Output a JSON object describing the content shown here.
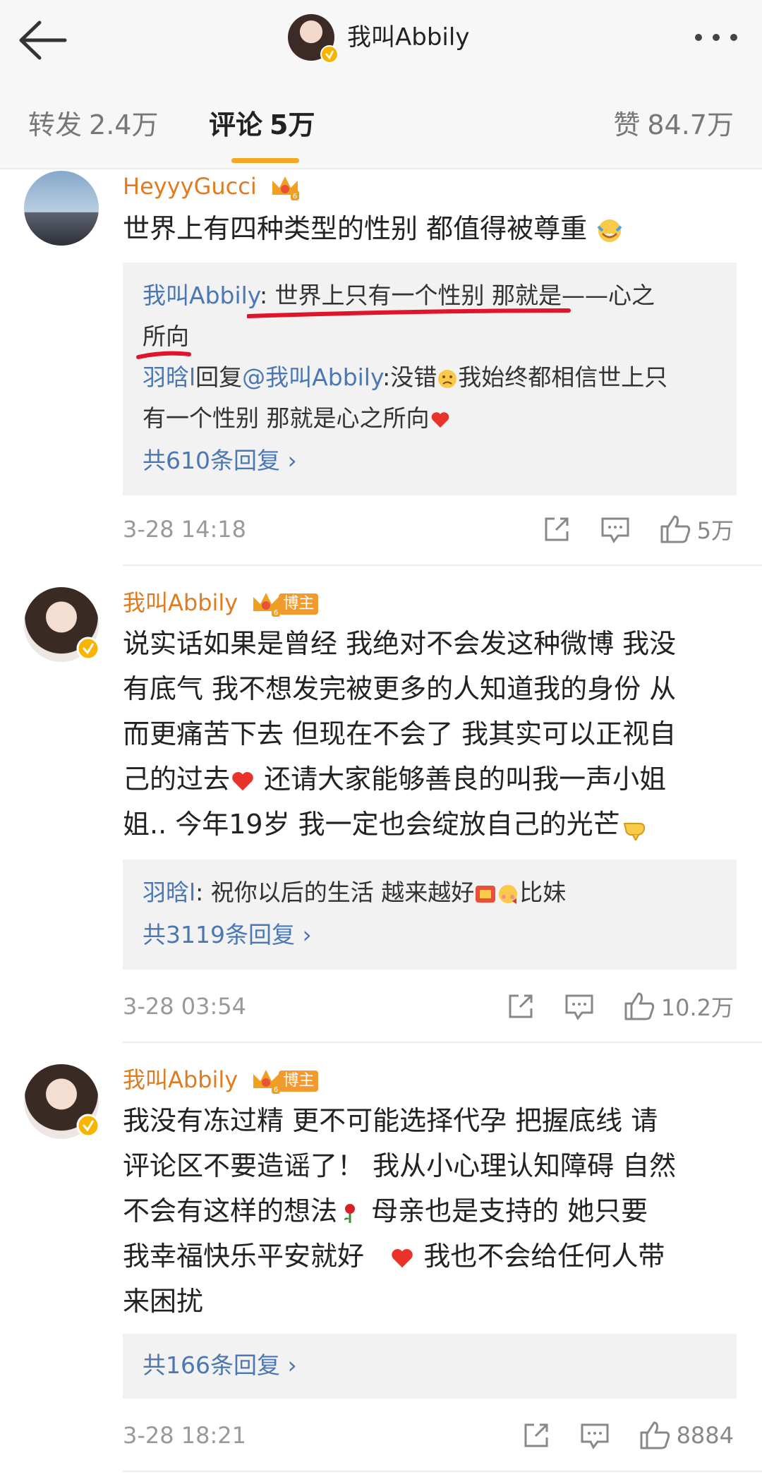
{
  "header": {
    "title": "我叫Abbily"
  },
  "tabs": {
    "repost_label": "转发",
    "repost_count": "2.4万",
    "comments_label": "评论",
    "comments_count": "5万",
    "likes_label": "赞",
    "likes_count": "84.7万"
  },
  "colors": {
    "accent": "#f5a623",
    "username": "#e07c1f",
    "link": "#4b78b3",
    "annotation_red": "#e0142b"
  },
  "comments": [
    {
      "username": "HeyyyGucci",
      "text": "世界上有四种类型的性别 都值得被尊重",
      "replies": [
        {
          "name": "我叫Abbily",
          "sep": ": ",
          "text_a": "世界上只有一个性别 那就是——心之",
          "text_b": "所向"
        },
        {
          "name": "羽晗l",
          "mid": "回复",
          "mention": "@我叫Abbily",
          "text_a": ":没错",
          "text_b": "我始终都相信世上只",
          "text_c": "有一个性别 那就是心之所向"
        }
      ],
      "more_replies": "共610条回复 ›",
      "time": "3-28 14:18",
      "like_count": "5万"
    },
    {
      "username": "我叫Abbily",
      "tag": "博主",
      "text_lines": [
        "说实话如果是曾经 我绝对不会发这种微博 我没",
        "有底气 我不想发完被更多的人知道我的身份 从",
        "而更痛苦下去 但现在不会了 我其实可以正视自",
        "己的过去",
        " 还请大家能够善良的叫我一声小姐",
        "姐.. 今年19岁 我一定也会绽放自己的光芒"
      ],
      "reply": {
        "name": "羽晗l",
        "sep": ": ",
        "text_a": "祝你以后的生活 越来越好",
        "text_b": "比妹"
      },
      "more_replies": "共3119条回复 ›",
      "time": "3-28 03:54",
      "like_count": "10.2万"
    },
    {
      "username": "我叫Abbily",
      "tag": "博主",
      "text_lines": [
        "我没有冻过精 更不可能选择代孕 把握底线  请",
        "评论区不要造谣了！ 我从小心理认知障碍 自然",
        "不会有这样的想法",
        " 母亲也是支持的 她只要",
        "我幸福快乐平安就好",
        " 我也不会给任何人带",
        "来困扰"
      ],
      "more_replies": "共166条回复 ›",
      "time": "3-28 18:21",
      "like_count": "8884"
    }
  ]
}
